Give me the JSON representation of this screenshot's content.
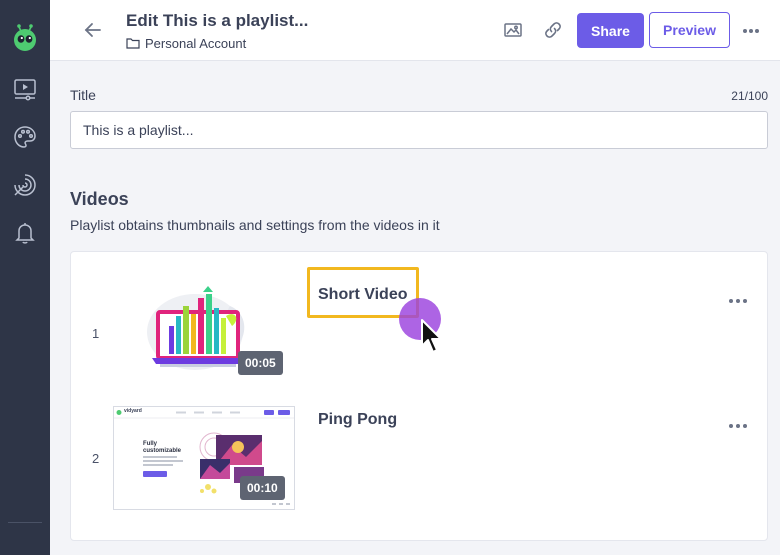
{
  "header": {
    "title": "Edit This is a playlist...",
    "account": "Personal Account",
    "share_label": "Share",
    "preview_label": "Preview"
  },
  "form": {
    "title_label": "Title",
    "char_count": "21/100",
    "title_value": "This is a playlist..."
  },
  "videos": {
    "heading": "Videos",
    "description": "Playlist obtains thumbnails and settings from the videos in it",
    "items": [
      {
        "index": "1",
        "title": "Short Video",
        "duration": "00:05"
      },
      {
        "index": "2",
        "title": "Ping Pong",
        "duration": "00:10"
      }
    ]
  },
  "thumbnail_site": {
    "brand": "vidyard",
    "headline_1": "Fully",
    "headline_2": "customizable"
  },
  "colors": {
    "accent": "#6c5ce7",
    "sidebar": "#2e3547",
    "highlight": "#f2b81f",
    "cursor_glow": "#9b42de"
  },
  "icons": {
    "sidebar": [
      "app-logo-icon",
      "video-library-icon",
      "palette-icon",
      "analytics-icon",
      "bell-icon"
    ],
    "toolbar": [
      "back-arrow-icon",
      "folder-icon",
      "image-icon",
      "link-icon",
      "more-horizontal-icon"
    ]
  }
}
